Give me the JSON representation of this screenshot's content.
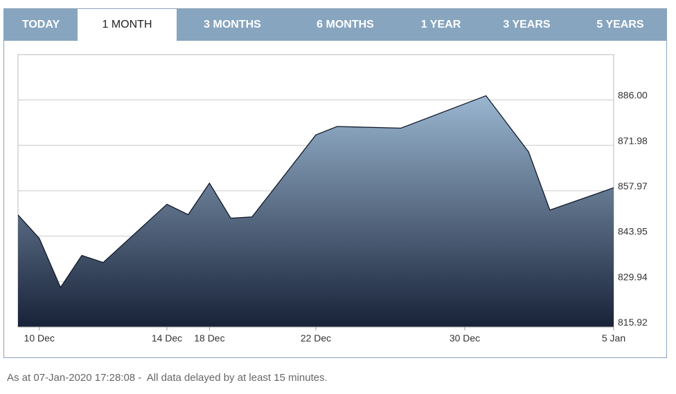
{
  "tabs": [
    {
      "label": "TODAY",
      "active": false
    },
    {
      "label": "1 MONTH",
      "active": true
    },
    {
      "label": "3 MONTHS",
      "active": false
    },
    {
      "label": "6 MONTHS",
      "active": false
    },
    {
      "label": "1 YEAR",
      "active": false
    },
    {
      "label": "3 YEARS",
      "active": false
    },
    {
      "label": "5 YEARS",
      "active": false
    }
  ],
  "footer": {
    "text": "As at 07-Jan-2020 17:28:08 -  All data delayed by at least 15 minutes."
  },
  "colors": {
    "tab_bar": "#88a5bf",
    "area_top": "#9ab6d0",
    "area_bottom": "#182238",
    "line": "#111a2b",
    "grid": "#c8c8c8"
  },
  "chart_data": {
    "type": "area",
    "x": [
      "2019-12-09",
      "2019-12-10",
      "2019-12-11",
      "2019-12-12",
      "2019-12-13",
      "2019-12-16",
      "2019-12-17",
      "2019-12-18",
      "2019-12-19",
      "2019-12-20",
      "2019-12-23",
      "2019-12-24",
      "2019-12-27",
      "2019-12-30",
      "2019-12-31",
      "2020-01-02",
      "2020-01-03",
      "2020-01-06"
    ],
    "y": [
      850.5,
      843.3,
      828.1,
      838.0,
      835.8,
      853.8,
      850.6,
      860.3,
      849.5,
      849.9,
      875.2,
      877.8,
      877.3,
      884.8,
      887.3,
      870.0,
      852.0,
      858.9
    ],
    "x_ticks": [
      {
        "date": "2019-12-10",
        "label": "10 Dec"
      },
      {
        "date": "2019-12-16",
        "label": "14 Dec"
      },
      {
        "date": "2019-12-18",
        "label": "18 Dec"
      },
      {
        "date": "2019-12-23",
        "label": "22 Dec"
      },
      {
        "date": "2019-12-30",
        "label": "30 Dec"
      },
      {
        "date": "2020-01-06",
        "label": "5 Jan"
      }
    ],
    "y_ticks": [
      815.92,
      829.94,
      843.95,
      857.97,
      871.98,
      886.0
    ],
    "y_tick_labels": [
      "815.92",
      "829.94",
      "843.95",
      "857.97",
      "871.98",
      "886.00"
    ],
    "ylim": [
      815.92,
      900.0
    ],
    "y_axis_position": "right",
    "grid": true,
    "title": "",
    "xlabel": "",
    "ylabel": ""
  }
}
